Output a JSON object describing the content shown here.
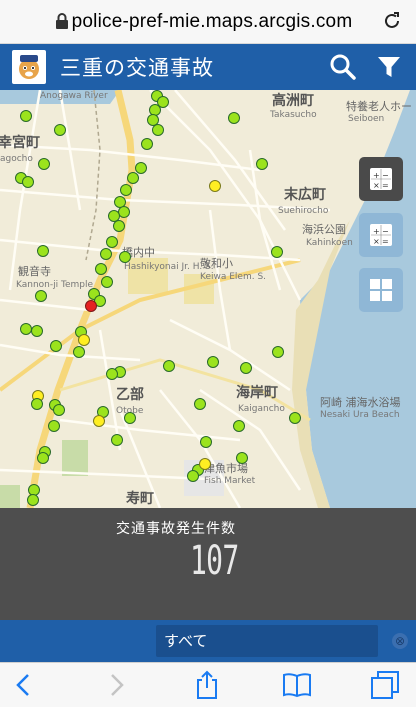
{
  "browser": {
    "url": "police-pref-mie.maps.arcgis.com",
    "icons": [
      "lock-icon",
      "reload-icon"
    ]
  },
  "app": {
    "title": "三重の交通事故",
    "icons": [
      "search-icon",
      "filter-icon"
    ]
  },
  "map": {
    "labels": {
      "takasu_ja": "高洲町",
      "takasu_en": "Takasucho",
      "tokuyo": "特養老人ホー",
      "seiboen": "Seiboen",
      "shiroi": "幸宮町",
      "shiroi_en": "agocho",
      "anogawa": "Anogawa River",
      "suehiro_ja": "末広町",
      "suehiro_en": "Suehirocho",
      "kaihin_ja": "海浜公園",
      "kaihin_en": "Kahinkoen",
      "kannon_ja": "観音寺",
      "kannon_en": "Kannon-ji Temple",
      "kaigan_ja": "海岸町",
      "kaigan_en": "Kaigancho",
      "otobe_ja": "乙部",
      "otobe_en": "Otobe",
      "nesaki_ja": "阿崎 浦海水浴場",
      "nesaki_en": "Nesaki Ura Beach",
      "fish_ja": "津魚市場",
      "fish_en": "Fish Market",
      "kotobuki": "寿町",
      "school1": "橋内中",
      "school1_en": "Hashikyonai Jr. H. S.",
      "school2": "敬和小",
      "school2_en": "Keiwa Elem. S."
    },
    "tools": [
      "calculator-icon",
      "calculator-icon",
      "grid-icon"
    ]
  },
  "stats": {
    "title": "交通事故発生件数",
    "count": "107"
  },
  "filter": {
    "selected": "すべて",
    "close_label": "⊗"
  },
  "toolbar": {
    "icons": [
      "back-icon",
      "forward-icon",
      "share-icon",
      "bookmarks-icon",
      "tabs-icon"
    ]
  }
}
